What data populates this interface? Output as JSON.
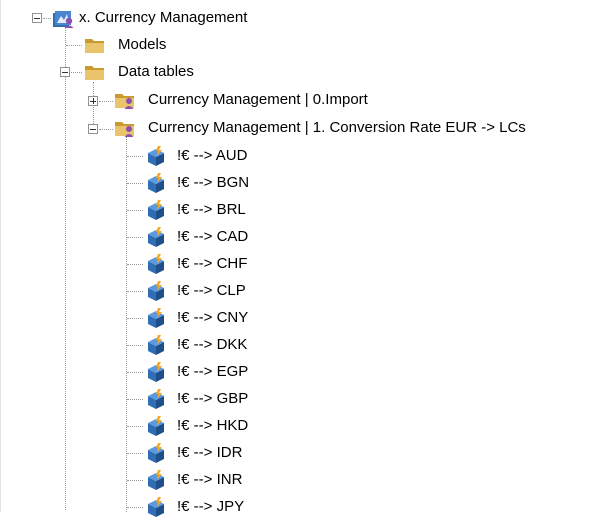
{
  "tree": {
    "root": {
      "label": "x. Currency Management",
      "icon": "model-group-icon",
      "expanded": true
    },
    "models": {
      "label": "Models",
      "icon": "folder-icon"
    },
    "data_tables": {
      "label": "Data tables",
      "icon": "folder-icon",
      "expanded": true
    },
    "import_table": {
      "label": "Currency Management | 0.Import",
      "icon": "data-table-folder-icon",
      "expanded": false
    },
    "conversion_table": {
      "label": "Currency Management | 1. Conversion Rate EUR -> LCs",
      "icon": "data-table-folder-icon",
      "expanded": true
    },
    "rates": [
      {
        "label": "!€ --> AUD",
        "icon": "data-cube-icon"
      },
      {
        "label": "!€ --> BGN",
        "icon": "data-cube-icon"
      },
      {
        "label": "!€ --> BRL",
        "icon": "data-cube-icon"
      },
      {
        "label": "!€ --> CAD",
        "icon": "data-cube-icon"
      },
      {
        "label": "!€ --> CHF",
        "icon": "data-cube-icon"
      },
      {
        "label": "!€ --> CLP",
        "icon": "data-cube-icon"
      },
      {
        "label": "!€ --> CNY",
        "icon": "data-cube-icon"
      },
      {
        "label": "!€ --> DKK",
        "icon": "data-cube-icon"
      },
      {
        "label": "!€ --> EGP",
        "icon": "data-cube-icon"
      },
      {
        "label": "!€ --> GBP",
        "icon": "data-cube-icon"
      },
      {
        "label": "!€ --> HKD",
        "icon": "data-cube-icon"
      },
      {
        "label": "!€ --> IDR",
        "icon": "data-cube-icon"
      },
      {
        "label": "!€ --> INR",
        "icon": "data-cube-icon"
      },
      {
        "label": "!€ --> JPY",
        "icon": "data-cube-icon"
      }
    ]
  },
  "colors": {
    "folder": "#e9c46a",
    "folder_dark": "#c99a2e",
    "accent_blue": "#2f6db5",
    "accent_purple": "#8a4fb0",
    "cube_orange": "#f5a623"
  }
}
